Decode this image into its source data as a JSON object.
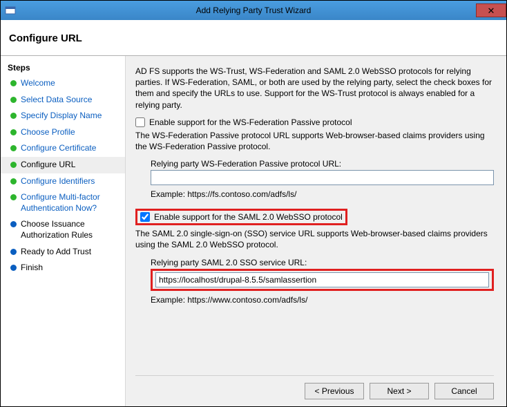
{
  "window": {
    "title": "Add Relying Party Trust Wizard",
    "close_glyph": "✕"
  },
  "header": {
    "title": "Configure URL"
  },
  "sidebar": {
    "title": "Steps",
    "items": [
      {
        "label": "Welcome"
      },
      {
        "label": "Select Data Source"
      },
      {
        "label": "Specify Display Name"
      },
      {
        "label": "Choose Profile"
      },
      {
        "label": "Configure Certificate"
      },
      {
        "label": "Configure URL"
      },
      {
        "label": "Configure Identifiers"
      },
      {
        "label": "Configure Multi-factor Authentication Now?"
      },
      {
        "label": "Choose Issuance Authorization Rules"
      },
      {
        "label": "Ready to Add Trust"
      },
      {
        "label": "Finish"
      }
    ]
  },
  "content": {
    "intro": "AD FS supports the WS-Trust, WS-Federation and SAML 2.0 WebSSO protocols for relying parties.  If WS-Federation, SAML, or both are used by the relying party, select the check boxes for them and specify the URLs to use.  Support for the WS-Trust protocol is always enabled for a relying party.",
    "wsfed": {
      "checkbox_label": "Enable support for the WS-Federation Passive protocol",
      "desc": "The WS-Federation Passive protocol URL supports Web-browser-based claims providers using the WS-Federation Passive protocol.",
      "field_label": "Relying party WS-Federation Passive protocol URL:",
      "value": "",
      "example": "Example: https://fs.contoso.com/adfs/ls/"
    },
    "saml": {
      "checkbox_label": "Enable support for the SAML 2.0 WebSSO protocol",
      "desc": "The SAML 2.0 single-sign-on (SSO) service URL supports Web-browser-based claims providers using the SAML 2.0 WebSSO protocol.",
      "field_label": "Relying party SAML 2.0 SSO service URL:",
      "value": "https://localhost/drupal-8.5.5/samlassertion",
      "example": "Example: https://www.contoso.com/adfs/ls/"
    }
  },
  "footer": {
    "previous": "< Previous",
    "next": "Next >",
    "cancel": "Cancel"
  }
}
